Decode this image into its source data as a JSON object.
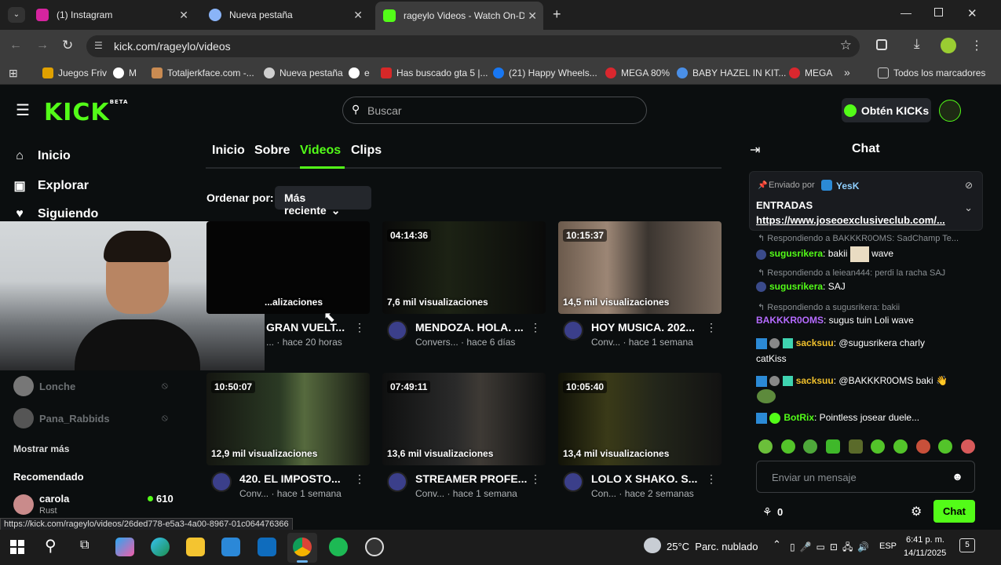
{
  "browser": {
    "tabs": [
      {
        "title": "(1) Instagram",
        "color": "#d6249f"
      },
      {
        "title": "Nueva pestaña",
        "color": "#8ab4f8"
      },
      {
        "title": "rageylo Videos - Watch On-Der",
        "color": "#53fc18"
      }
    ],
    "url": "kick.com/rageylo/videos",
    "bookmarks": [
      {
        "label": "Juegos Friv",
        "color": "#e0a100"
      },
      {
        "label": "M",
        "color": "#ffffff"
      },
      {
        "label": "Totaljerkface.com -...",
        "color": "#c98b52"
      },
      {
        "label": "Nueva pestaña",
        "color": "#cfcfcf"
      },
      {
        "label": "e",
        "color": "#ffffff"
      },
      {
        "label": "Has buscado gta 5 |...",
        "color": "#d62828"
      },
      {
        "label": "(21) Happy Wheels...",
        "color": "#1877f2"
      },
      {
        "label": "MEGA 80%",
        "color": "#d9272e"
      },
      {
        "label": "BABY HAZEL IN KIT...",
        "color": "#4a8fe7"
      },
      {
        "label": "MEGA",
        "color": "#d9272e"
      },
      {
        "label": "Todos los marcadores",
        "color": "#cfcfcf"
      }
    ],
    "status_url": "https://kick.com/rageylo/videos/26ded778-e5a3-4a00-8967-01c064476366"
  },
  "header": {
    "logo": "KICK",
    "logo_tag": "BETA",
    "search_placeholder": "Buscar",
    "kicks_button": "Obtén KICKs"
  },
  "sidebar": {
    "nav": [
      "Inicio",
      "Explorar",
      "Siguiendo"
    ],
    "following": [
      {
        "name": "Lonche"
      },
      {
        "name": "Pana_Rabbids"
      }
    ],
    "show_more": "Mostrar más",
    "recommended_title": "Recomendado",
    "recommended": [
      {
        "name": "carola",
        "category": "Rust",
        "viewers": "610"
      }
    ]
  },
  "channel": {
    "tabs": [
      "Inicio",
      "Sobre",
      "Videos",
      "Clips"
    ],
    "active_tab": "Videos",
    "sort_label": "Ordenar por:",
    "sort_value": "Más reciente",
    "accent": "#53fc18",
    "videos": [
      {
        "duration": "",
        "views": "...alizaciones",
        "title": "GRAN VUELT...",
        "category": "...",
        "age": "hace 20 horas"
      },
      {
        "duration": "04:14:36",
        "views": "7,6 mil visualizaciones",
        "title": "MENDOZA. HOLA. ...",
        "category": "Convers...",
        "age": "hace 6 días"
      },
      {
        "duration": "10:15:37",
        "views": "14,5 mil visualizaciones",
        "title": "HOY MUSICA. 202...",
        "category": "Conv...",
        "age": "hace 1 semana"
      },
      {
        "duration": "10:50:07",
        "views": "12,9 mil visualizaciones",
        "title": "420. EL IMPOSTO...",
        "category": "Conv...",
        "age": "hace 1 semana"
      },
      {
        "duration": "07:49:11",
        "views": "13,6 mil visualizaciones",
        "title": "STREAMER PROFE...",
        "category": "Conv...",
        "age": "hace 1 semana"
      },
      {
        "duration": "10:05:40",
        "views": "13,4 mil visualizaciones",
        "title": "LOLO X SHAKO. S...",
        "category": "Con...",
        "age": "hace 2 semanas"
      }
    ]
  },
  "chat": {
    "title": "Chat",
    "pinned": {
      "sent_by": "Enviado por",
      "author": "YesK",
      "title": "ENTRADAS",
      "link": "https://www.joseoexclusiveclub.com/..."
    },
    "messages": [
      {
        "reply": "Respondiendo a BAKKKR0OMS: SadChamp Te...",
        "user": "sugusrikera",
        "user_color": "#53fc18",
        "text": ": bakii",
        "extra": "wave"
      },
      {
        "reply": "Respondiendo a leiean444: perdi la racha SAJ",
        "user": "sugusrikera",
        "user_color": "#53fc18",
        "text": ": SAJ",
        "extra": ""
      },
      {
        "reply": "Respondiendo a sugusrikera: bakii",
        "user": "BAKKKR0OMS",
        "user_color": "#b56bff",
        "text": ": sugus tuin Loli wave",
        "extra": ""
      },
      {
        "reply": "",
        "user": "sacksuu",
        "user_color": "#f0c02c",
        "text": ": @sugusrikera charly",
        "extra": "catKiss"
      },
      {
        "reply": "",
        "user": "sacksuu",
        "user_color": "#f0c02c",
        "text": ": @BAKKKR0OMS baki",
        "extra": ""
      },
      {
        "reply": "",
        "user": "BotRix",
        "user_color": "#53fc18",
        "text": ": Pointless josear duele...",
        "extra": ""
      }
    ],
    "input_placeholder": "Enviar un mensaje",
    "points": "0",
    "send_button": "Chat"
  },
  "taskbar": {
    "weather": "25°C  Parc. nublado",
    "lang": "ESP",
    "time": "6:41 p. m.",
    "date": "14/11/2025",
    "notif": "5"
  }
}
